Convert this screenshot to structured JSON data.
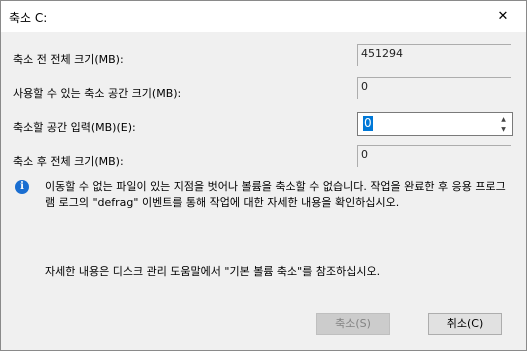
{
  "window": {
    "title": "축소 C:",
    "close_glyph": "✕"
  },
  "fields": {
    "total_before_label": "축소 전 전체 크기(MB):",
    "total_before_value": "451294",
    "available_label": "사용할 수 있는 축소 공간 크기(MB):",
    "available_value": "0",
    "shrink_label": "축소할 공간 입력(MB)(E):",
    "shrink_value": "0",
    "total_after_label": "축소 후 전체 크기(MB):",
    "total_after_value": "0"
  },
  "info": {
    "icon": "info-icon",
    "message": "이동할 수 없는 파일이 있는 지점을 벗어나 볼륨을 축소할 수 없습니다. 작업을 완료한 후 응용 프로그램 로그의 \"defrag\" 이벤트를 통해 작업에 대한 자세한 내용을 확인하십시오.",
    "help": "자세한 내용은 디스크 관리 도움말에서 \"기본 볼륨 축소\"를 참조하십시오."
  },
  "buttons": {
    "shrink": "축소(S)",
    "cancel": "취소(C)"
  },
  "colors": {
    "accent": "#0078d7",
    "info_blue": "#1a6ed1",
    "dialog_bg": "#f0f0f0"
  }
}
